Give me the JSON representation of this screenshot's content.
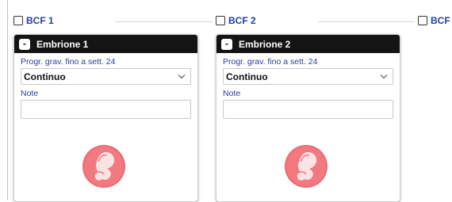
{
  "bcf_items": [
    {
      "label": "BCF 1",
      "checked": false
    },
    {
      "label": "BCF 2",
      "checked": false
    },
    {
      "label": "BCF",
      "checked": false
    }
  ],
  "cards": [
    {
      "title": "Embrione 1",
      "collapse_symbol": "-",
      "progress_label": "Progr. grav. fino a sett. 24",
      "progress_value": "Continuo",
      "note_label": "Note",
      "note_value": "",
      "icon": "fetus-icon"
    },
    {
      "title": "Embrione 2",
      "collapse_symbol": "-",
      "progress_label": "Progr. grav. fino a sett. 24",
      "progress_value": "Continuo",
      "note_label": "Note",
      "note_value": "",
      "icon": "fetus-icon"
    }
  ],
  "colors": {
    "header_bg": "#141414",
    "label_blue": "#2b3b9b",
    "bcf_blue": "#1f3fa0",
    "icon_circle": "#ec6b73"
  }
}
